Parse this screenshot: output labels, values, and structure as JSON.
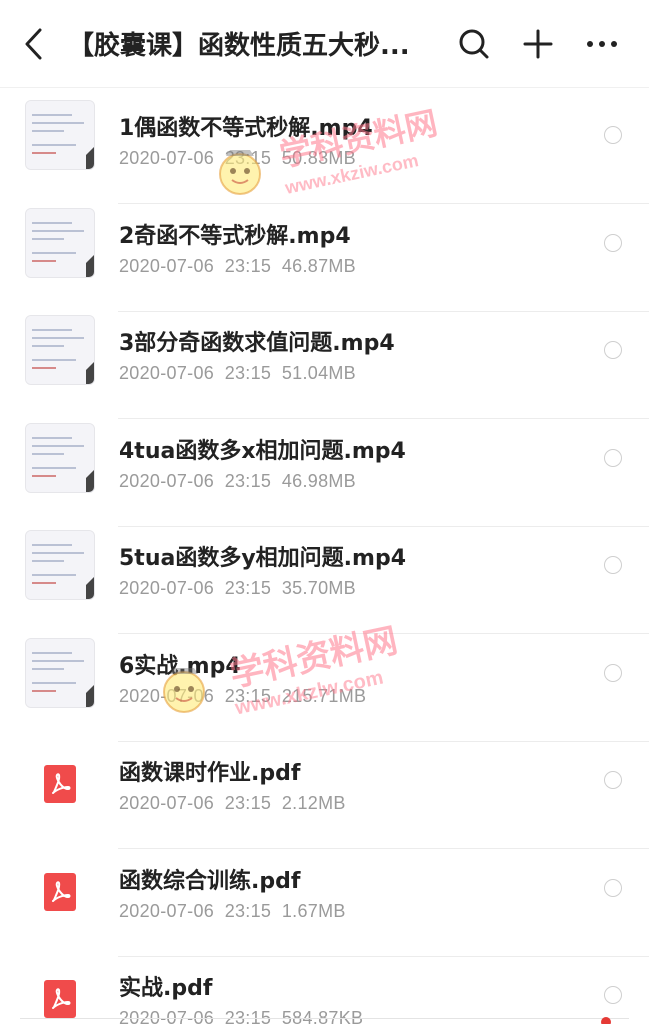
{
  "header": {
    "title": "【胶囊课】函数性质五大秒...",
    "back_icon": "chevron-left-icon",
    "search_icon": "search-icon",
    "add_icon": "plus-icon",
    "more_icon": "more-horizontal-icon"
  },
  "files": [
    {
      "name": "1偶函数不等式秒解.mp4",
      "date": "2020-07-06",
      "time": "23:15",
      "size": "50.83MB",
      "type": "video"
    },
    {
      "name": "2奇函不等式秒解.mp4",
      "date": "2020-07-06",
      "time": "23:15",
      "size": "46.87MB",
      "type": "video"
    },
    {
      "name": "3部分奇函数求值问题.mp4",
      "date": "2020-07-06",
      "time": "23:15",
      "size": "51.04MB",
      "type": "video"
    },
    {
      "name": "4tua函数多x相加问题.mp4",
      "date": "2020-07-06",
      "time": "23:15",
      "size": "46.98MB",
      "type": "video"
    },
    {
      "name": "5tua函数多y相加问题.mp4",
      "date": "2020-07-06",
      "time": "23:15",
      "size": "35.70MB",
      "type": "video"
    },
    {
      "name": "6实战.mp4",
      "date": "2020-07-06",
      "time": "23:15",
      "size": "215.71MB",
      "type": "video"
    },
    {
      "name": "函数课时作业.pdf",
      "date": "2020-07-06",
      "time": "23:15",
      "size": "2.12MB",
      "type": "pdf"
    },
    {
      "name": "函数综合训练.pdf",
      "date": "2020-07-06",
      "time": "23:15",
      "size": "1.67MB",
      "type": "pdf"
    },
    {
      "name": "实战.pdf",
      "date": "2020-07-06",
      "time": "23:15",
      "size": "584.87KB",
      "type": "pdf"
    }
  ],
  "watermark": {
    "text": "学科资料网",
    "url_1": "www.xkziw.com",
    "url_2": "www.xkzlw.com"
  },
  "colors": {
    "pdf_red": "#f04b4b",
    "meta_gray": "#9a9a9a",
    "radio_border": "#cfcfcf",
    "watermark_pink": "#ff788c"
  }
}
